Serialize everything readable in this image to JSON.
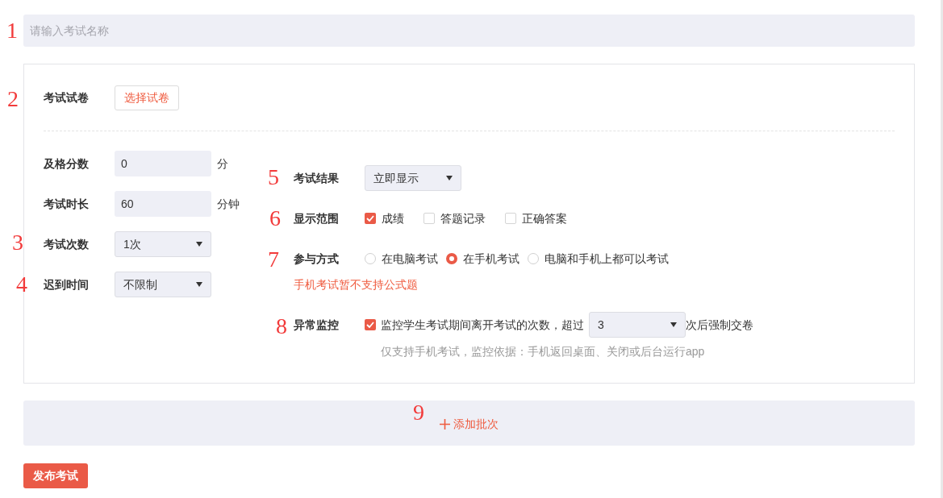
{
  "name_field": {
    "marker": "1",
    "placeholder": "请输入考试名称"
  },
  "paper": {
    "marker": "2",
    "label": "考试试卷",
    "button": "选择试卷"
  },
  "left_fields": [
    {
      "kind": "input",
      "label": "及格分数",
      "value": "0",
      "unit": "分"
    },
    {
      "kind": "input",
      "label": "考试时长",
      "value": "60",
      "unit": "分钟"
    },
    {
      "kind": "select",
      "marker": "3",
      "label": "考试次数",
      "value": "1次"
    },
    {
      "kind": "select",
      "marker": "4",
      "label": "迟到时间",
      "value": "不限制"
    }
  ],
  "right_fields": [
    {
      "kind": "select",
      "marker": "5",
      "label": "考试结果",
      "value": "立即显示"
    },
    {
      "kind": "checkboxes",
      "marker": "6",
      "label": "显示范围",
      "options": [
        {
          "label": "成绩",
          "checked": true
        },
        {
          "label": "答题记录",
          "checked": false
        },
        {
          "label": "正确答案",
          "checked": false
        }
      ]
    },
    {
      "kind": "radios",
      "marker": "7",
      "label": "参与方式",
      "options": [
        {
          "label": "在电脑考试",
          "selected": false
        },
        {
          "label": "在手机考试",
          "selected": true
        },
        {
          "label": "电脑和手机上都可以考试",
          "selected": false
        }
      ],
      "warning": "手机考试暂不支持公式题"
    },
    {
      "kind": "monitor",
      "marker": "8",
      "label": "异常监控",
      "checked": true,
      "text": "监控学生考试期间离开考试的次数，超过",
      "value": "3",
      "suffix": "次后强制交卷",
      "hint": "仅支持手机考试，监控依据：手机返回桌面、关闭或后台运行app"
    }
  ],
  "add_batch": {
    "marker": "9",
    "label": "添加批次"
  },
  "publish_button": "发布考试"
}
